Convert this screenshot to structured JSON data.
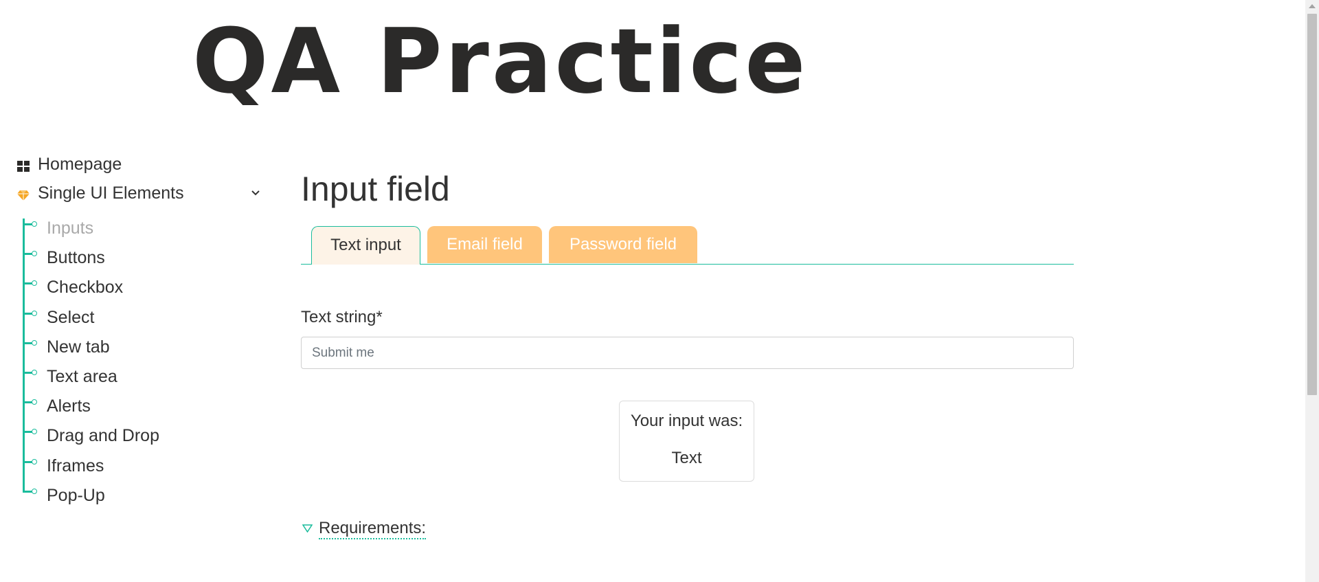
{
  "logo": {
    "text": "QA Practice"
  },
  "sidebar": {
    "homepage_label": "Homepage",
    "section_label": "Single UI Elements",
    "items": [
      {
        "label": "Inputs",
        "active": true
      },
      {
        "label": "Buttons"
      },
      {
        "label": "Checkbox"
      },
      {
        "label": "Select"
      },
      {
        "label": "New tab"
      },
      {
        "label": "Text area"
      },
      {
        "label": "Alerts"
      },
      {
        "label": "Drag and Drop"
      },
      {
        "label": "Iframes"
      },
      {
        "label": "Pop-Up"
      }
    ]
  },
  "main": {
    "title": "Input field",
    "tabs": [
      {
        "label": "Text input",
        "active": true
      },
      {
        "label": "Email field"
      },
      {
        "label": "Password field"
      }
    ],
    "field_label": "Text string*",
    "input": {
      "placeholder": "Submit me",
      "value": ""
    },
    "result": {
      "label": "Your input was:",
      "value": "Text"
    },
    "requirements_label": "Requirements:"
  },
  "colors": {
    "accent": "#1abc9c",
    "tab_inactive": "#ffc57b",
    "tab_active_bg": "#fdf3e7",
    "text": "#333333",
    "muted": "#a9a9a9",
    "diamond_icon": "#f5a623"
  },
  "icons": {
    "homepage": "grid-icon",
    "section": "diamond-icon",
    "section_toggle": "chevron-down-icon",
    "requirements_toggle": "triangle-down-icon"
  }
}
